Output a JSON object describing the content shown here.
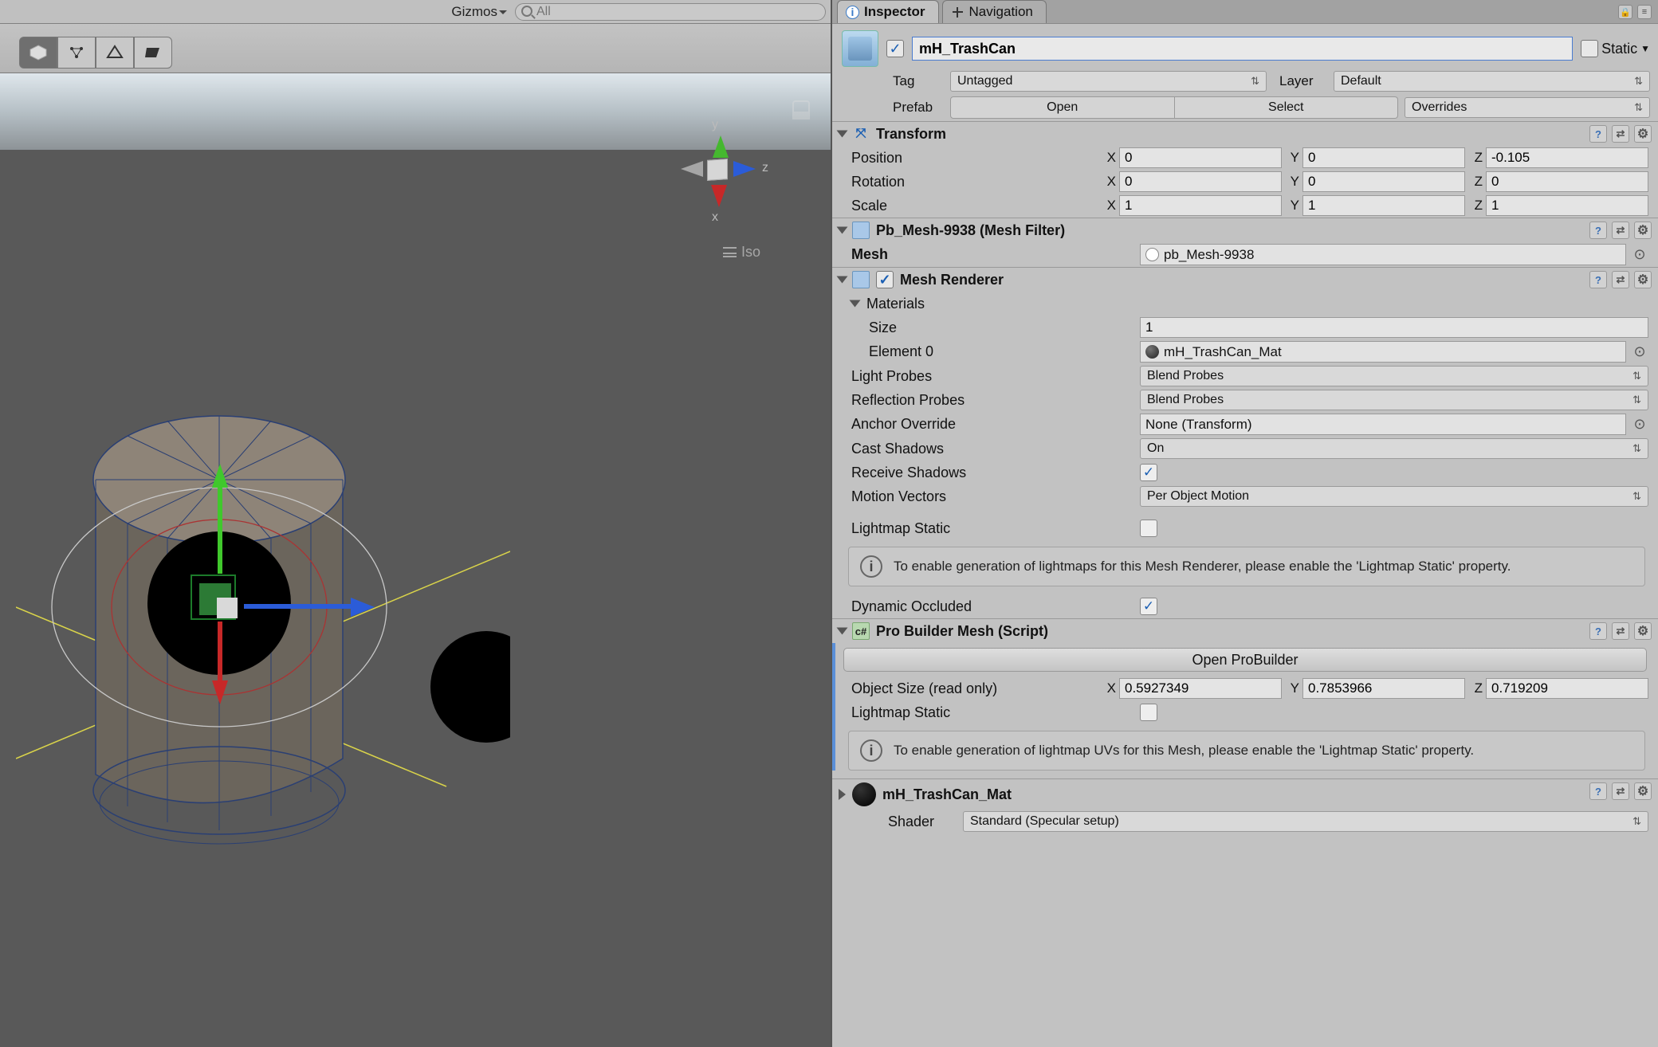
{
  "scene": {
    "gizmos_label": "Gizmos",
    "search_placeholder": "All",
    "projection": "Iso",
    "axes": {
      "x": "x",
      "y": "y",
      "z": "z"
    }
  },
  "tabs": {
    "inspector": "Inspector",
    "navigation": "Navigation"
  },
  "header": {
    "enabled": true,
    "name": "mH_TrashCan",
    "static_label": "Static",
    "tag_label": "Tag",
    "tag_value": "Untagged",
    "layer_label": "Layer",
    "layer_value": "Default",
    "prefab_label": "Prefab",
    "prefab_open": "Open",
    "prefab_select": "Select",
    "prefab_overrides": "Overrides"
  },
  "transform": {
    "title": "Transform",
    "position_label": "Position",
    "position": {
      "x": "0",
      "y": "0",
      "z": "-0.105"
    },
    "rotation_label": "Rotation",
    "rotation": {
      "x": "0",
      "y": "0",
      "z": "0"
    },
    "scale_label": "Scale",
    "scale": {
      "x": "1",
      "y": "1",
      "z": "1"
    }
  },
  "mesh_filter": {
    "title": "Pb_Mesh-9938 (Mesh Filter)",
    "mesh_label": "Mesh",
    "mesh_value": "pb_Mesh-9938"
  },
  "mesh_renderer": {
    "title": "Mesh Renderer",
    "materials_label": "Materials",
    "size_label": "Size",
    "size_value": "1",
    "element0_label": "Element 0",
    "element0_value": "mH_TrashCan_Mat",
    "light_probes_label": "Light Probes",
    "light_probes_value": "Blend Probes",
    "reflection_probes_label": "Reflection Probes",
    "reflection_probes_value": "Blend Probes",
    "anchor_override_label": "Anchor Override",
    "anchor_override_value": "None (Transform)",
    "cast_shadows_label": "Cast Shadows",
    "cast_shadows_value": "On",
    "receive_shadows_label": "Receive Shadows",
    "receive_shadows_checked": true,
    "motion_vectors_label": "Motion Vectors",
    "motion_vectors_value": "Per Object Motion",
    "lightmap_static_label": "Lightmap Static",
    "lightmap_info": "To enable generation of lightmaps for this Mesh Renderer, please enable the 'Lightmap Static' property.",
    "dynamic_occluded_label": "Dynamic Occluded",
    "dynamic_occluded_checked": true
  },
  "probuilder": {
    "title": "Pro Builder Mesh (Script)",
    "open_btn": "Open ProBuilder",
    "object_size_label": "Object Size (read only)",
    "object_size": {
      "x": "0.5927349",
      "y": "0.7853966",
      "z": "0.719209"
    },
    "lightmap_static_label": "Lightmap Static",
    "lightmap_info": "To enable generation of lightmap UVs for this Mesh, please enable the 'Lightmap Static' property."
  },
  "material": {
    "title": "mH_TrashCan_Mat",
    "shader_label": "Shader",
    "shader_value": "Standard (Specular setup)"
  }
}
